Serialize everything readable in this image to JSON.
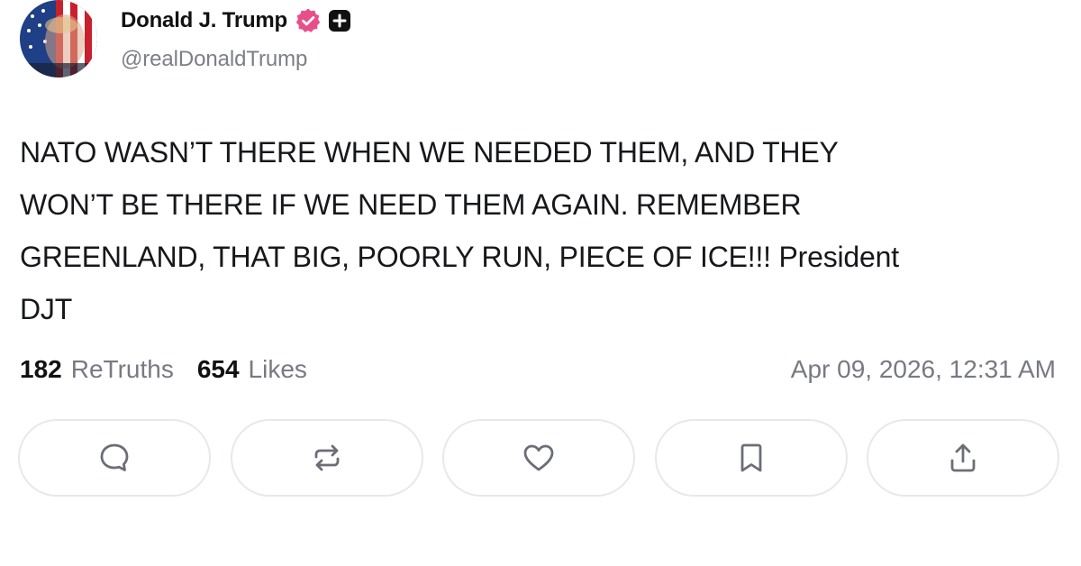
{
  "author": {
    "display_name": "Donald J. Trump",
    "handle": "@realDonaldTrump",
    "avatar_icon": "avatar-american-flag",
    "verified_badge_color": "#e84f8a",
    "verified_icon": "verified-badge-icon",
    "plus_icon": "truth-plus-icon"
  },
  "post": {
    "text": "NATO WASN’T THERE WHEN WE NEEDED THEM, AND THEY\nWON’T BE THERE IF WE NEED THEM AGAIN. REMEMBER\nGREENLAND, THAT BIG, POORLY RUN, PIECE OF ICE!!! President\nDJT"
  },
  "stats": {
    "retruths_count": "182",
    "retruths_label": "ReTruths",
    "likes_count": "654",
    "likes_label": "Likes",
    "timestamp": "Apr 09, 2026, 12:31 AM"
  },
  "actions": [
    {
      "name": "reply",
      "icon": "comment-icon"
    },
    {
      "name": "retruth",
      "icon": "repost-icon"
    },
    {
      "name": "like",
      "icon": "heart-icon"
    },
    {
      "name": "bookmark",
      "icon": "bookmark-icon"
    },
    {
      "name": "share",
      "icon": "share-icon"
    }
  ],
  "colors": {
    "text": "#16181c",
    "muted": "#777a82",
    "border": "#e7e8ec",
    "icon": "#6b6e76"
  }
}
